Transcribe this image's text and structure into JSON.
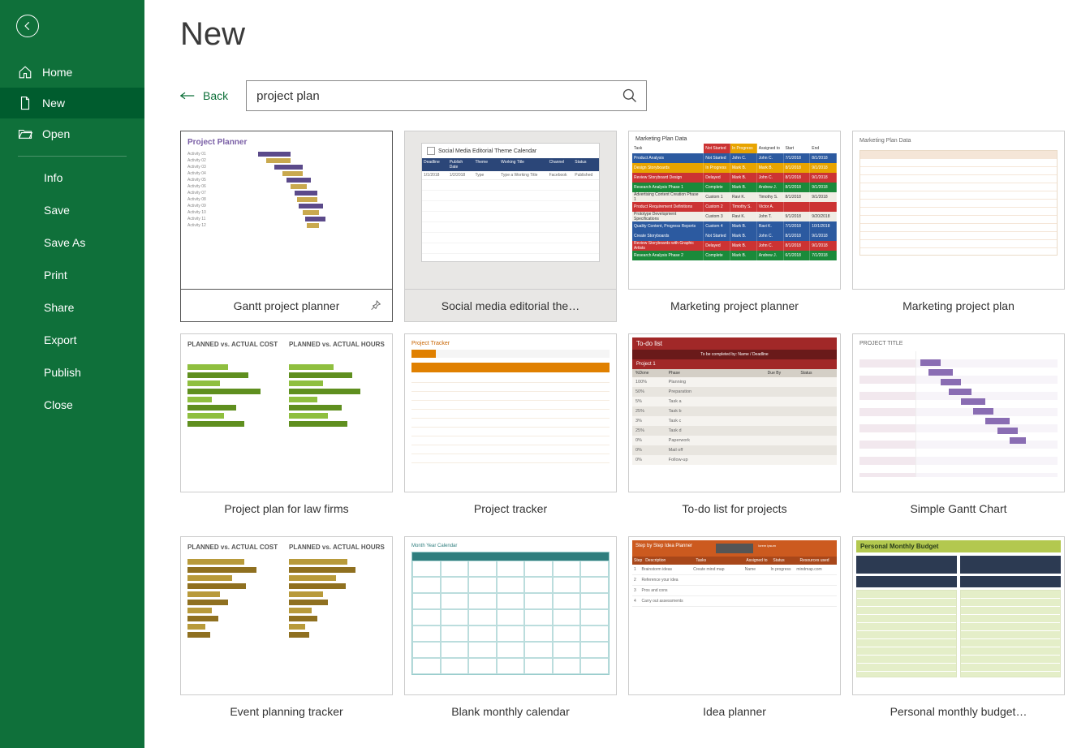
{
  "sidebar": {
    "items": [
      {
        "label": "Home"
      },
      {
        "label": "New"
      },
      {
        "label": "Open"
      }
    ],
    "plain": [
      "Info",
      "Save",
      "Save As",
      "Print",
      "Share",
      "Export",
      "Publish",
      "Close"
    ]
  },
  "page": {
    "title": "New",
    "back": "Back",
    "search_value": "project plan"
  },
  "templates": [
    {
      "label": "Gantt project planner"
    },
    {
      "label": "Social media editorial the…"
    },
    {
      "label": "Marketing project planner"
    },
    {
      "label": "Marketing project plan"
    },
    {
      "label": "Project plan for law firms"
    },
    {
      "label": "Project tracker"
    },
    {
      "label": "To-do list for projects"
    },
    {
      "label": "Simple Gantt Chart"
    },
    {
      "label": "Event planning tracker"
    },
    {
      "label": "Blank monthly calendar"
    },
    {
      "label": "Idea planner"
    },
    {
      "label": "Personal monthly budget…"
    }
  ],
  "thumbs": {
    "gantt_title": "Project Planner",
    "mpd_title": "Marketing Plan Data",
    "mpd2_title": "Marketing Plan Data",
    "sme_title": "Social Media Editorial Theme Calendar",
    "todo_title": "To-do list",
    "pt_title": "Project Tracker",
    "sgc_title": "PROJECT TITLE",
    "law_t1": "PLANNED vs. ACTUAL COST",
    "law_t2": "PLANNED vs. ACTUAL HOURS",
    "evt_t1": "PLANNED vs. ACTUAL COST",
    "evt_t2": "PLANNED vs. ACTUAL HOURS",
    "idea_title": "Step by Step Idea Planner",
    "pmb_title": "Personal Monthly Budget",
    "cal_hdr": "Month  Year  Calendar"
  }
}
